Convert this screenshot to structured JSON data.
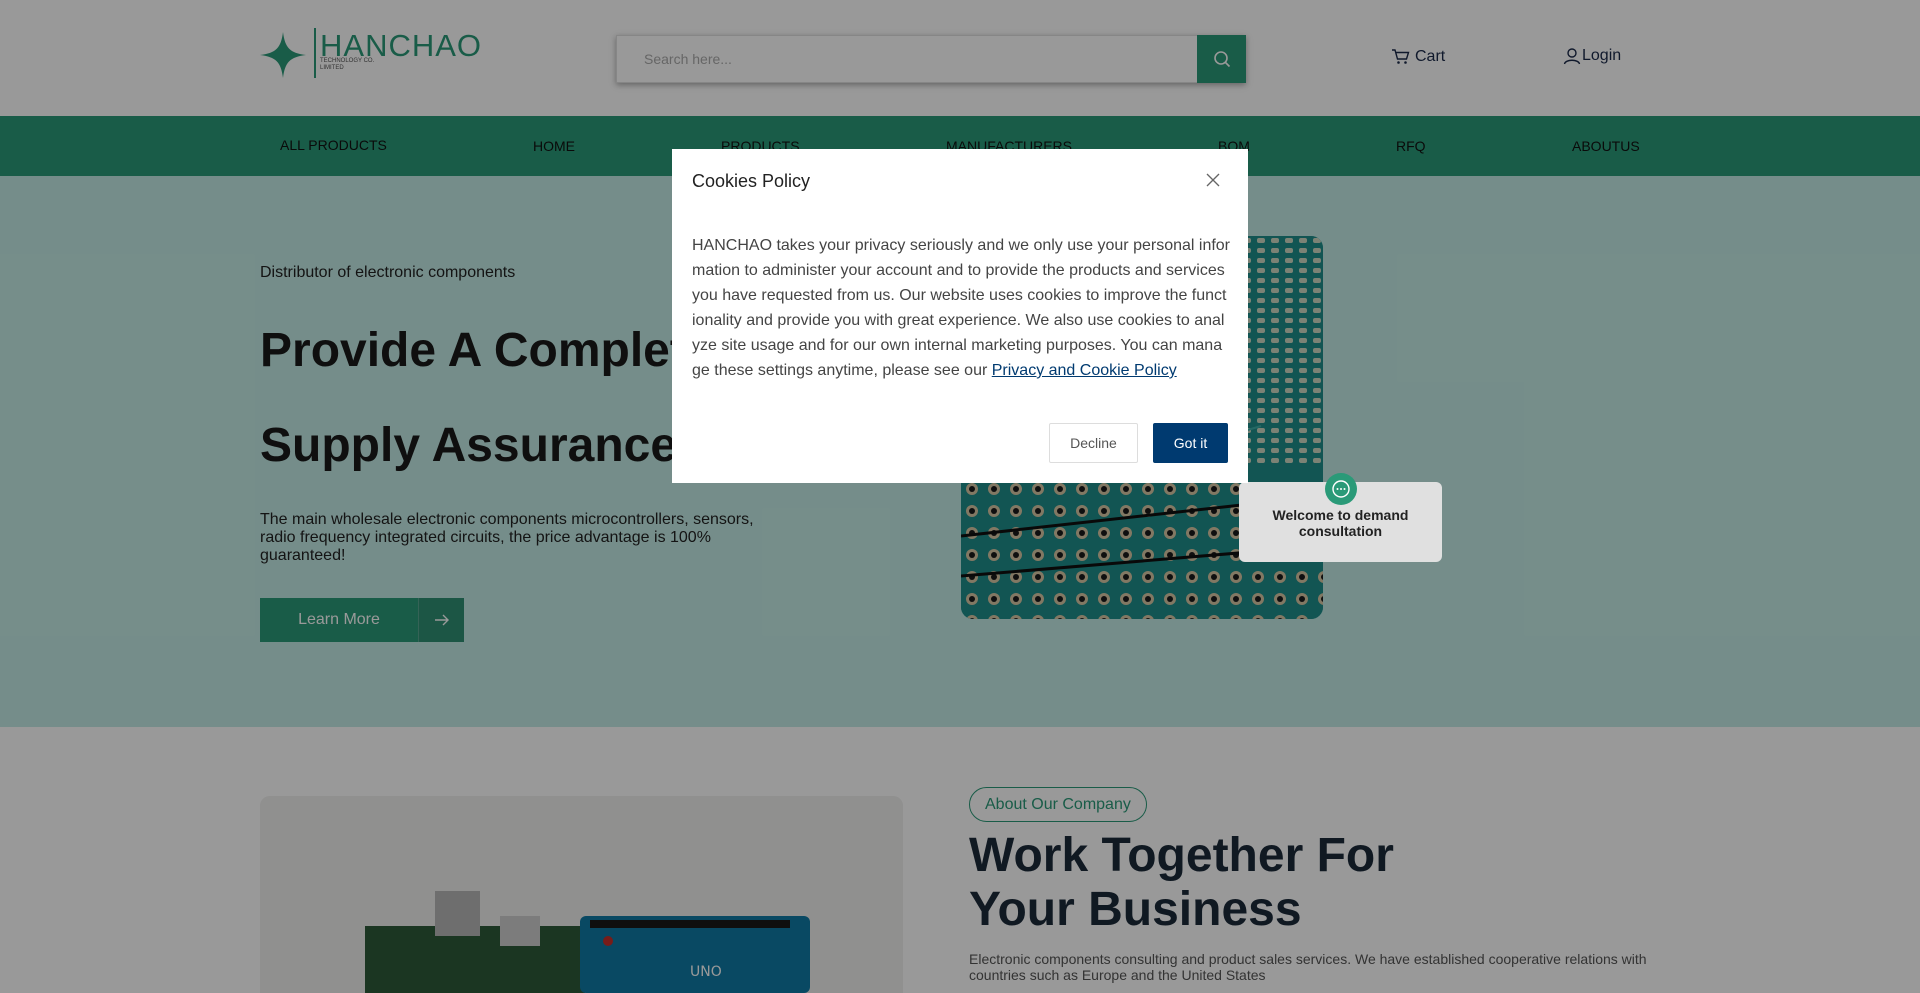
{
  "colors": {
    "brand": "#2a9a78",
    "hero_bg": "#c4ece6",
    "primary_button": "#003a70"
  },
  "header": {
    "logo_name": "HANCHAO",
    "logo_subtitle": "TECHNOLOGY CO. LIMITED",
    "search": {
      "placeholder": "Search here...",
      "icon": "search-icon"
    },
    "cart_label": "Cart",
    "login_label": "Login"
  },
  "nav": {
    "items": [
      {
        "label": "ALL PRODUCTS"
      },
      {
        "label": "HOME"
      },
      {
        "label": "PRODUCTS"
      },
      {
        "label": "MANUFACTURERS"
      },
      {
        "label": "BOM"
      },
      {
        "label": "RFQ"
      },
      {
        "label": "ABOUTUS"
      }
    ]
  },
  "hero": {
    "tagline": "Distributor of electronic components",
    "headline_line1": "Provide A Complete",
    "headline_line2": "Supply Assurance",
    "description": "The main wholesale electronic components microcontrollers, sensors, radio frequency integrated circuits, the price advantage is 100% guaranteed!",
    "button_label": "Learn More"
  },
  "about": {
    "pill_label": "About Our Company",
    "headline_line1": "Work Together For",
    "headline_line2": "Your Business",
    "description": "Electronic components consulting and product sales services. We have established cooperative relations with countries such as Europe and the United States"
  },
  "chat": {
    "text": "Welcome to demand consultation"
  },
  "cookie_modal": {
    "title": "Cookies Policy",
    "body": "HANCHAO takes your privacy seriously and we only use your personal information to administer your account and to provide the products and services you have requested from us. Our website uses cookies to improve the functionality and provide you with great experience. We also use cookies to analyze site usage and for our own internal marketing purposes. You can manage these settings anytime, please see our ",
    "link_label": "Privacy and Cookie Policy",
    "decline_label": "Decline",
    "accept_label": "Got it"
  }
}
